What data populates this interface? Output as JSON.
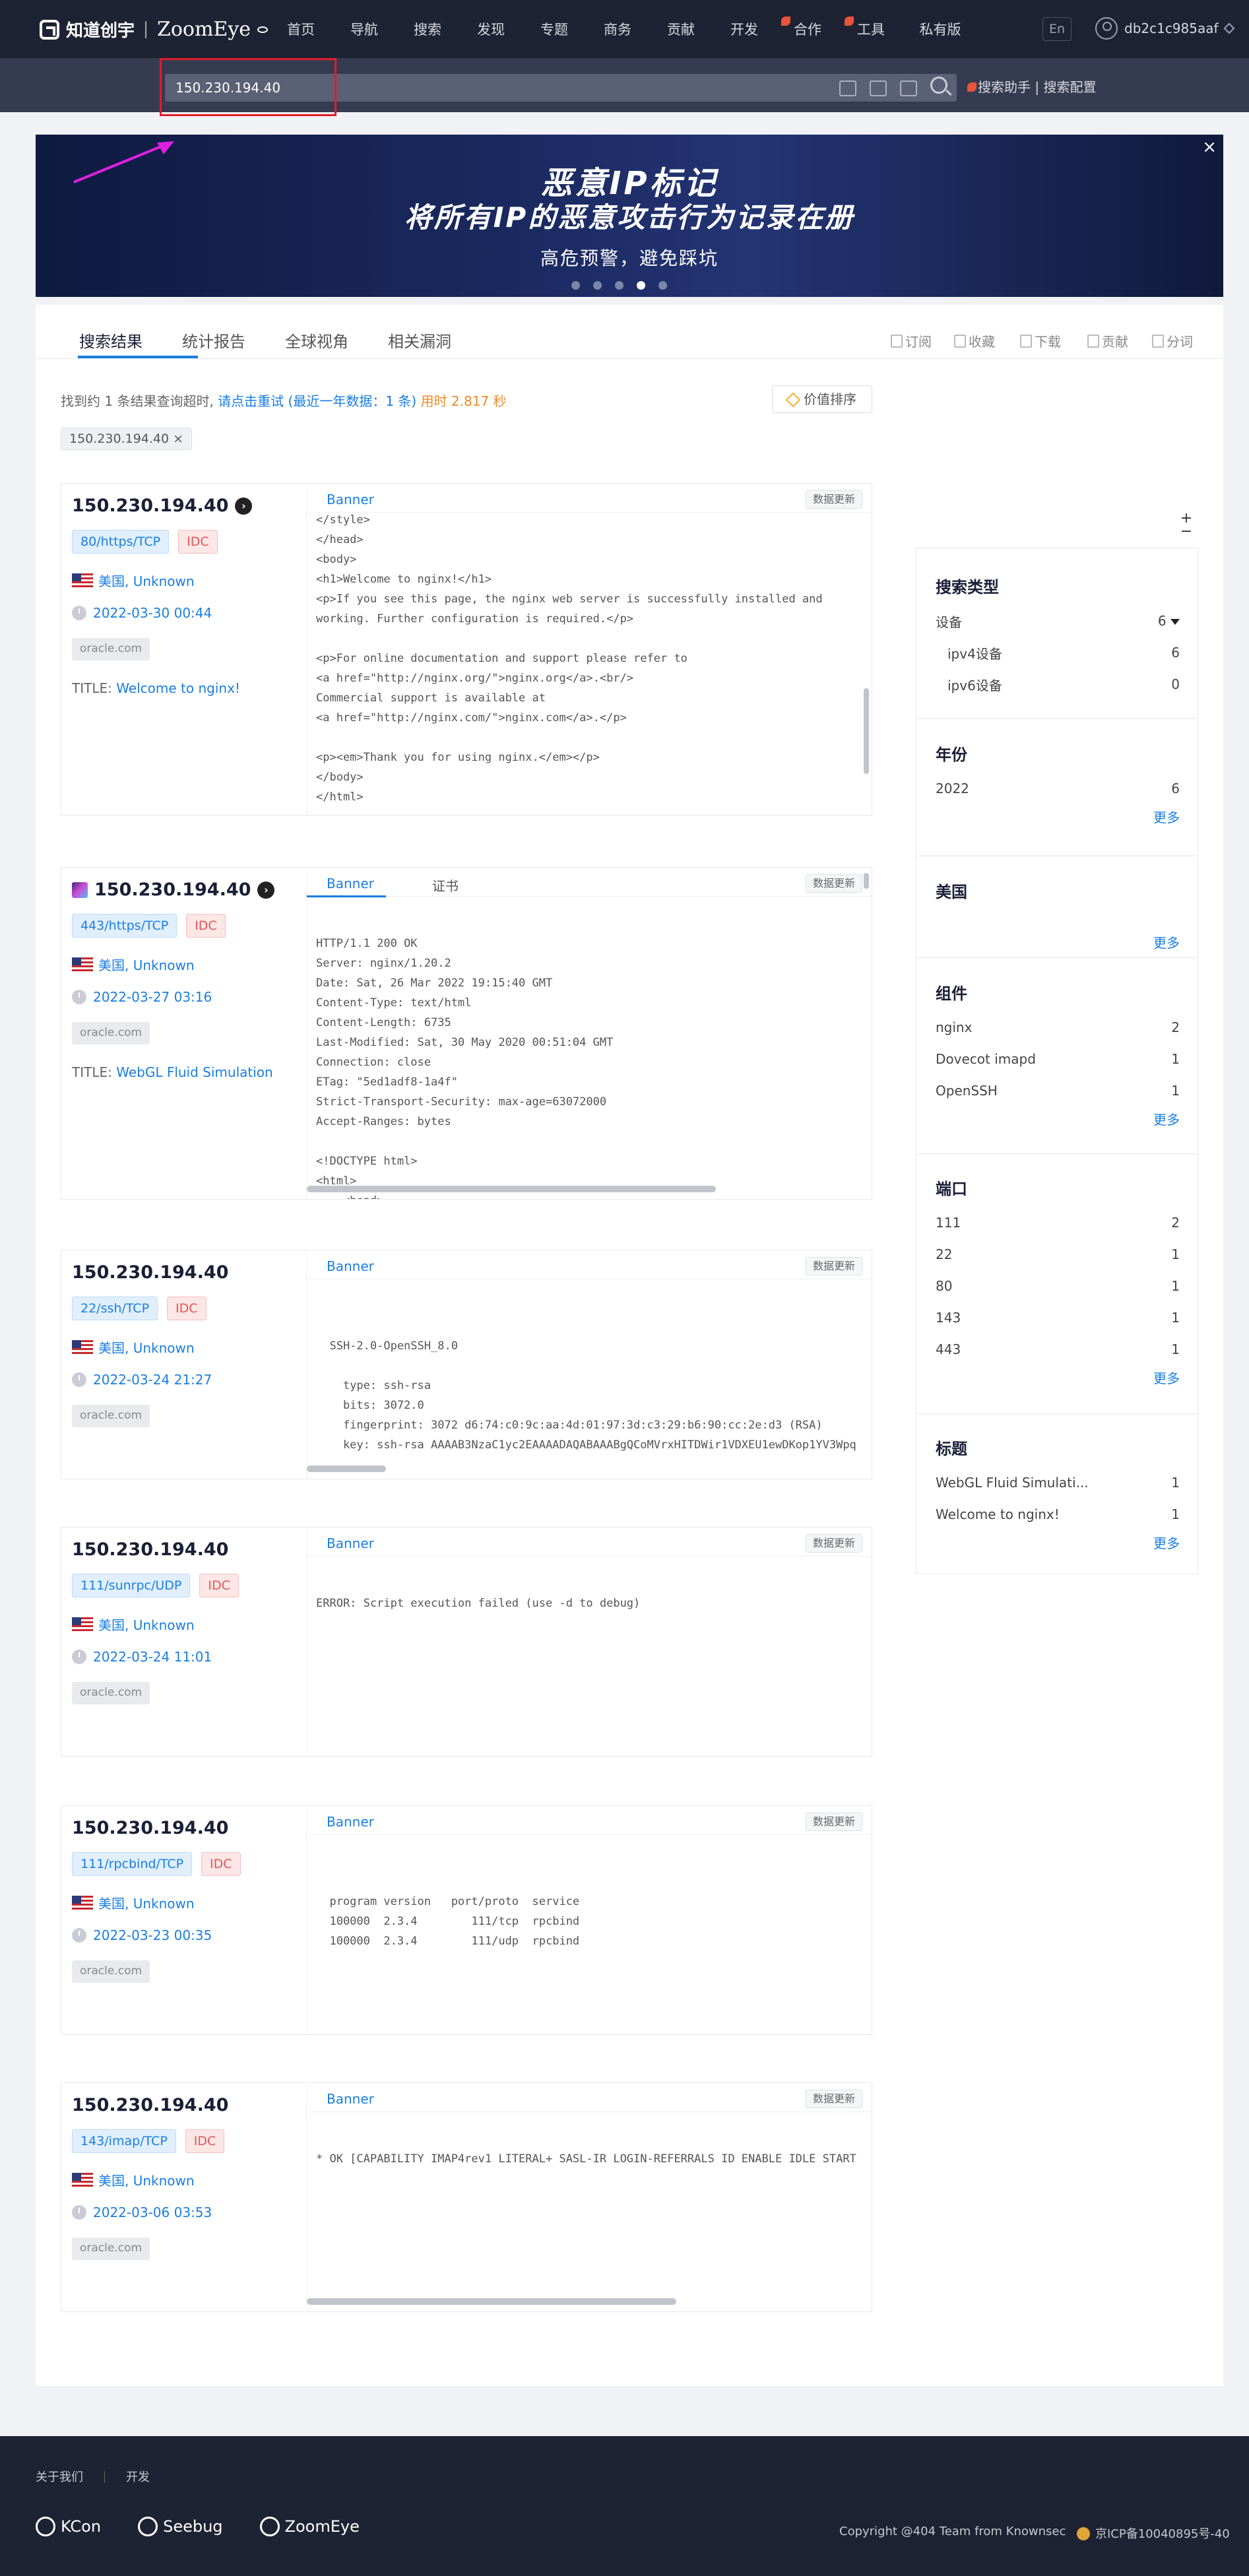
{
  "nav": {
    "brand_cn": "知道创宇",
    "brand_en": "ZoomEye",
    "links": [
      "首页",
      "导航",
      "搜索",
      "发现",
      "专题",
      "商务",
      "贡献",
      "开发",
      "合作",
      "工具",
      "私有版"
    ],
    "lang": "En",
    "username": "db2c1c985aaf"
  },
  "search": {
    "value": "150.230.194.40",
    "assistant_label": "搜索助手",
    "config_label": "搜索配置"
  },
  "banner": {
    "headline": "恶意IP标记",
    "subline": "将所有IP的恶意攻击行为记录在册",
    "tagline": "高危预警，避免踩坑",
    "slide_count": 5,
    "active_slide": 4,
    "close_symbol": "×"
  },
  "tabs": [
    "搜索结果",
    "统计报告",
    "全球视角",
    "相关漏洞"
  ],
  "tools": [
    "订阅",
    "收藏",
    "下载",
    "贡献",
    "分词"
  ],
  "summary": {
    "prefix": "找到约 1 条结果查询超时,",
    "retry_link": "请点击重试 (最近一年数据：1 条)",
    "time_label": "用时 2.817 秒",
    "sort_label": "价值排序",
    "chip": "150.230.194.40",
    "chip_close": "×"
  },
  "common": {
    "banner_tab": "Banner",
    "cert_tab": "证书",
    "update_label": "数据更新",
    "title_prefix": "TITLE: ",
    "idc": "IDC",
    "org": "oracle.com",
    "geo": "美国, Unknown"
  },
  "results": [
    {
      "ip": "150.230.194.40",
      "port": "80/https/TCP",
      "date": "2022-03-30 00:44",
      "title": "Welcome to nginx!",
      "code": "</style>\n</head>\n<body>\n<h1>Welcome to nginx!</h1>\n<p>If you see this page, the nginx web server is successfully installed and\nworking. Further configuration is required.</p>\n\n<p>For online documentation and support please refer to\n<a href=\"http://nginx.org/\">nginx.org</a>.<br/>\nCommercial support is available at\n<a href=\"http://nginx.com/\">nginx.com</a>.</p>\n\n<p><em>Thank you for using nginx.</em></p>\n</body>\n</html>"
    },
    {
      "ip": "150.230.194.40",
      "port": "443/https/TCP",
      "date": "2022-03-27 03:16",
      "title": "WebGL Fluid Simulation",
      "code": "HTTP/1.1 200 OK\nServer: nginx/1.20.2\nDate: Sat, 26 Mar 2022 19:15:40 GMT\nContent-Type: text/html\nContent-Length: 6735\nLast-Modified: Sat, 30 May 2020 00:51:04 GMT\nConnection: close\nETag: \"5ed1adf8-1a4f\"\nStrict-Transport-Security: max-age=63072000\nAccept-Ranges: bytes\n\n<!DOCTYPE html>\n<html>\n    <head>"
    },
    {
      "ip": "150.230.194.40",
      "port": "22/ssh/TCP",
      "date": "2022-03-24 21:27",
      "code": "\n  SSH-2.0-OpenSSH_8.0\n\n    type: ssh-rsa\n    bits: 3072.0\n    fingerprint: 3072 d6:74:c0:9c:aa:4d:01:97:3d:c3:29:b6:90:cc:2e:d3 (RSA)\n    key: ssh-rsa AAAAB3NzaC1yc2EAAAADAQABAAABgQCoMVrxHITDWir1VDXEU1ewDKop1YV3Wpq"
    },
    {
      "ip": "150.230.194.40",
      "port": "111/sunrpc/UDP",
      "date": "2022-03-24 11:01",
      "code": "ERROR: Script execution failed (use -d to debug)"
    },
    {
      "ip": "150.230.194.40",
      "port": "111/rpcbind/TCP",
      "date": "2022-03-23 00:35",
      "code": "\n  program version   port/proto  service\n  100000  2.3.4        111/tcp  rpcbind\n  100000  2.3.4        111/udp  rpcbind"
    },
    {
      "ip": "150.230.194.40",
      "port": "143/imap/TCP",
      "date": "2022-03-06 03:53",
      "code": "* OK [CAPABILITY IMAP4rev1 LITERAL+ SASL-IR LOGIN-REFERRALS ID ENABLE IDLE START"
    }
  ],
  "sidebar": {
    "plus": "+",
    "minus": "−",
    "more": "更多",
    "search_type": {
      "title": "搜索类型",
      "rows": [
        [
          "设备",
          "6"
        ],
        [
          "ipv4设备",
          "6"
        ],
        [
          "ipv6设备",
          "0"
        ]
      ]
    },
    "year": {
      "title": "年份",
      "rows": [
        [
          "2022",
          "6"
        ]
      ]
    },
    "country": {
      "title": "美国"
    },
    "component": {
      "title": "组件",
      "rows": [
        [
          "nginx",
          "2"
        ],
        [
          "Dovecot imapd",
          "1"
        ],
        [
          "OpenSSH",
          "1"
        ]
      ]
    },
    "port": {
      "title": "端口",
      "rows": [
        [
          "111",
          "2"
        ],
        [
          "22",
          "1"
        ],
        [
          "80",
          "1"
        ],
        [
          "143",
          "1"
        ],
        [
          "443",
          "1"
        ]
      ]
    },
    "titles": {
      "title": "标题",
      "rows": [
        [
          "WebGL Fluid Simulati...",
          "1"
        ],
        [
          "Welcome to nginx!",
          "1"
        ]
      ]
    }
  },
  "footer": {
    "links": [
      "关于我们",
      "开发"
    ],
    "logos": [
      "KCon",
      "Seebug",
      "ZoomEye"
    ],
    "copyright": "Copyright @404 Team from Knownsec",
    "icp": "京ICP备10040895号-40"
  },
  "colors": {
    "nav_bg": "#1e2333",
    "accent": "#1a7ee0",
    "idc_red": "#e05656",
    "time_orange": "#f08a24",
    "highlight_box": "#e11d2a",
    "arrow": "#e020e0"
  }
}
